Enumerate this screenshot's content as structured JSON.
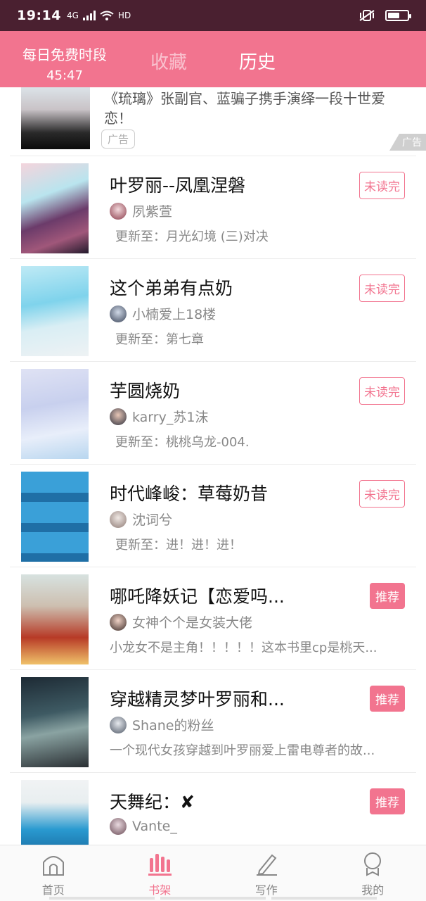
{
  "status_bar": {
    "time": "19:14",
    "network": "4G",
    "hd": "HD"
  },
  "header": {
    "free_title": "每日免费时段",
    "free_timer": "45:47",
    "tab_favorites": "收藏",
    "tab_history": "历史"
  },
  "ad": {
    "title": "《琉璃》张副官、蓝骗子携手演绎一段十世爱恋！",
    "tag": "广告",
    "corner": "广告"
  },
  "books": [
    {
      "title": "叶罗丽--凤凰涅磐",
      "author": "夙紫萱",
      "subtitle": "更新至：月光幻境 (三)对决",
      "badge": "未读完"
    },
    {
      "title": "这个弟弟有点奶",
      "author": "小楠爱上18楼",
      "subtitle": "更新至：第七章",
      "badge": "未读完"
    },
    {
      "title": "芋圆烧奶",
      "author": "karry_苏1沫",
      "subtitle": "更新至：桃桃乌龙-004.",
      "badge": "未读完"
    },
    {
      "title": "时代峰峻：草莓奶昔",
      "author": "沈词兮",
      "subtitle": "更新至：进！进！进！",
      "badge": "未读完"
    },
    {
      "title": "哪吒降妖记【恋爱吗...",
      "author": "女神个个是女装大佬",
      "subtitle": "小龙女不是主角！！！！！这本书里cp是桃天...",
      "badge": "推荐"
    },
    {
      "title": "穿越精灵梦叶罗丽和...",
      "author": "Shane的粉丝",
      "subtitle": "一个现代女孩穿越到叶罗丽爱上雷电尊者的故...",
      "badge": "推荐"
    },
    {
      "title": "天舞纪：✘",
      "author": "Vante_",
      "subtitle": "",
      "badge": "推荐"
    }
  ],
  "bottom_nav": {
    "home": "首页",
    "shelf": "书架",
    "write": "写作",
    "me": "我的"
  },
  "colors": {
    "accent": "#f2748f",
    "status_bar": "#4a2030"
  }
}
